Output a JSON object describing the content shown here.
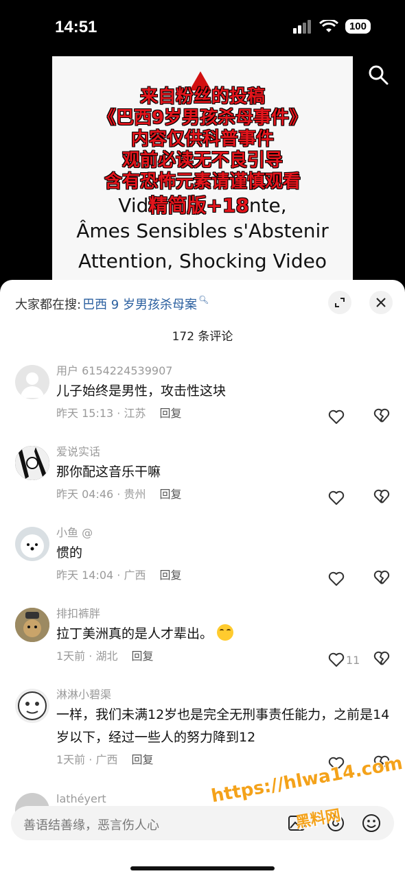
{
  "status": {
    "time": "14:51",
    "battery": "100"
  },
  "video": {
    "cn_lines": [
      "来自粉丝的投稿",
      "《巴西9岁男孩杀母事件》",
      "内容仅供科普事件",
      "观前必读无不良引导",
      "含有恐怖元素请谨慎观看"
    ],
    "fr_line1_prefix": "Vid",
    "fr_line1_red": "精简版+18",
    "fr_line1_suffix": "nte,",
    "fr_line2": "Âmes Sensibles s'Abstenir",
    "fr_line3": "Attention, Shocking Video"
  },
  "sheet": {
    "hot_label": "大家都在搜:",
    "hot_query": "巴西 9 岁男孩杀母案",
    "comment_count": "172 条评论"
  },
  "comments": [
    {
      "user": "用户 6154224539907",
      "text": "儿子始终是男性，攻击性这块",
      "time": "昨天 15:13 · 江苏",
      "reply": "回复",
      "likes": ""
    },
    {
      "user": "爱说实话",
      "text": "那你配这音乐干嘛",
      "time": "昨天 04:46 · 贵州",
      "reply": "回复",
      "likes": ""
    },
    {
      "user": "小鱼 @",
      "text": "惯的",
      "time": "昨天 14:04 · 广西",
      "reply": "回复",
      "likes": ""
    },
    {
      "user": "排扣裤胖",
      "text": "拉丁美洲真的是人才辈出。",
      "time": "1天前 · 湖北",
      "reply": "回复",
      "likes": "11"
    },
    {
      "user": "淋淋小碧渠",
      "text": "一样，我们未满12岁也是完全无刑事责任能力，之前是14岁以下，经过一些人的努力降到12",
      "time": "1天前 · 广西",
      "reply": "回复",
      "likes": ""
    },
    {
      "user": "lathéyert",
      "text": "",
      "time": "",
      "reply": "",
      "likes": ""
    }
  ],
  "input": {
    "placeholder": "善语结善缘，恶言伤人心"
  },
  "watermark": {
    "url": "https://hlwa14.com",
    "cn": "黑料网"
  },
  "colors": {
    "link": "#2a5f9f",
    "video_red": "#e4151c",
    "watermark": "#f4a21a"
  }
}
